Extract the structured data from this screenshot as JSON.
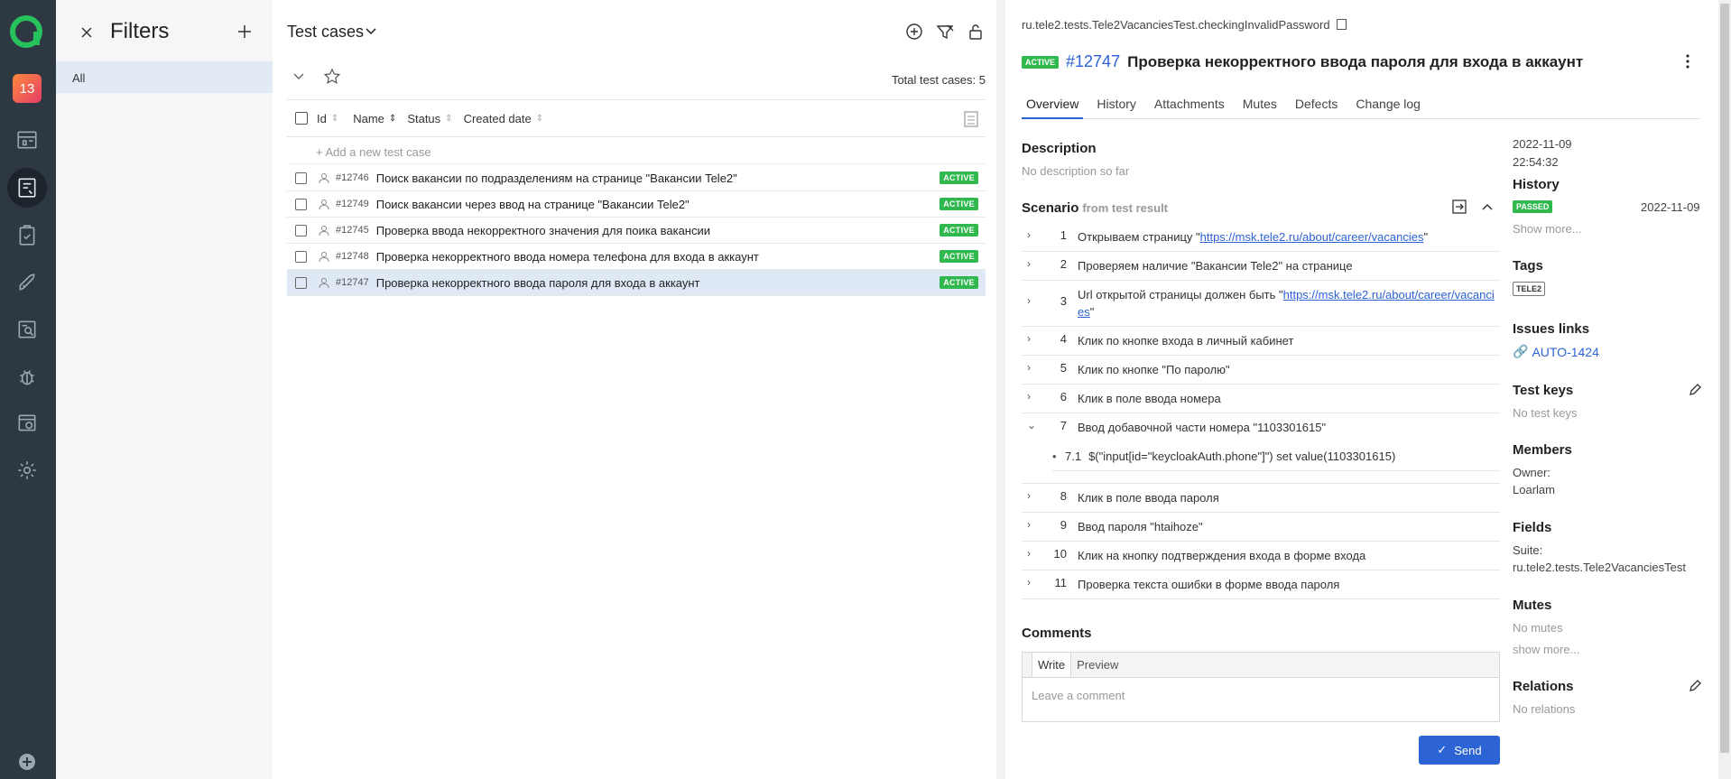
{
  "rail": {
    "badge": "13"
  },
  "filters": {
    "title": "Filters",
    "all": "All"
  },
  "list": {
    "title": "Test cases",
    "total": "Total test cases: 5",
    "columns": [
      "Id",
      "Name",
      "Status",
      "Created date"
    ],
    "add_label": "Add a new test case",
    "rows": [
      {
        "id": "#12746",
        "name": "Поиск вакансии по подразделениям на странице \"Вакансии Tele2\"",
        "status": "ACTIVE"
      },
      {
        "id": "#12749",
        "name": "Поиск вакансии через ввод на странице \"Вакансии Tele2\"",
        "status": "ACTIVE"
      },
      {
        "id": "#12745",
        "name": "Проверка ввода некорректного значения для поика вакансии",
        "status": "ACTIVE"
      },
      {
        "id": "#12748",
        "name": "Проверка некорректного ввода номера телефона для входа в аккаунт",
        "status": "ACTIVE"
      },
      {
        "id": "#12747",
        "name": "Проверка некорректного ввода пароля для входа в аккаунт",
        "status": "ACTIVE"
      }
    ]
  },
  "detail": {
    "path": "ru.tele2.tests.Tele2VacanciesTest.checkingInvalidPassword",
    "status": "ACTIVE",
    "number": "#12747",
    "title": "Проверка некорректного ввода пароля для входа в аккаунт",
    "tabs": [
      "Overview",
      "History",
      "Attachments",
      "Mutes",
      "Defects",
      "Change log"
    ],
    "description_h": "Description",
    "description_v": "No description so far",
    "scenario_h": "Scenario",
    "scenario_sub": "from test result",
    "steps": [
      {
        "n": "1",
        "pre": "Открываем страницу \"",
        "link": "https://msk.tele2.ru/about/career/vacancies",
        "post": "\""
      },
      {
        "n": "2",
        "text": "Проверяем наличие \"Вакансии Tele2\" на странице"
      },
      {
        "n": "3",
        "pre": "Url открытой страницы должен быть \"",
        "link": "https://msk.tele2.ru/about/career/vacancies",
        "post": "\""
      },
      {
        "n": "4",
        "text": "Клик по кнопке входа в личный кабинет"
      },
      {
        "n": "5",
        "text": "Клик по кнопке \"По паролю\""
      },
      {
        "n": "6",
        "text": "Клик в поле ввода номера"
      },
      {
        "n": "7",
        "text": "Ввод добавочной части номера \"1103301615\""
      },
      {
        "n": "8",
        "text": "Клик в поле ввода пароля"
      },
      {
        "n": "9",
        "text": "Ввод пароля \"htaihoze\""
      },
      {
        "n": "10",
        "text": "Клик на кнопку подтверждения входа в форме входа"
      },
      {
        "n": "11",
        "text": "Проверка текста ошибки в форме ввода пароля"
      }
    ],
    "substep": {
      "n": "7.1",
      "text": "$(\"input[id=\"keycloakAuth.phone\"]\") set value(1103301615)"
    },
    "comments_h": "Comments",
    "write": "Write",
    "preview": "Preview",
    "comment_placeholder": "Leave a comment",
    "send": "Send"
  },
  "side": {
    "date1": "2022-11-09",
    "time1": "22:54:32",
    "history_h": "History",
    "history_status": "PASSED",
    "history_date": "2022-11-09",
    "show_more": "Show more...",
    "tags_h": "Tags",
    "tag": "TELE2",
    "issues_h": "Issues links",
    "issue": "AUTO-1424",
    "keys_h": "Test keys",
    "keys_v": "No test keys",
    "members_h": "Members",
    "owner_label": "Owner:",
    "owner": "Loarlam",
    "fields_h": "Fields",
    "suite_label": "Suite:",
    "suite": "ru.tele2.tests.Tele2VacanciesTest",
    "mutes_h": "Mutes",
    "mutes_v": "No mutes",
    "mutes_more": "show more...",
    "relations_h": "Relations",
    "relations_v": "No relations"
  },
  "colors": {
    "accent": "#2c63d5",
    "active": "#2fb84d",
    "rail": "#2d3843"
  }
}
